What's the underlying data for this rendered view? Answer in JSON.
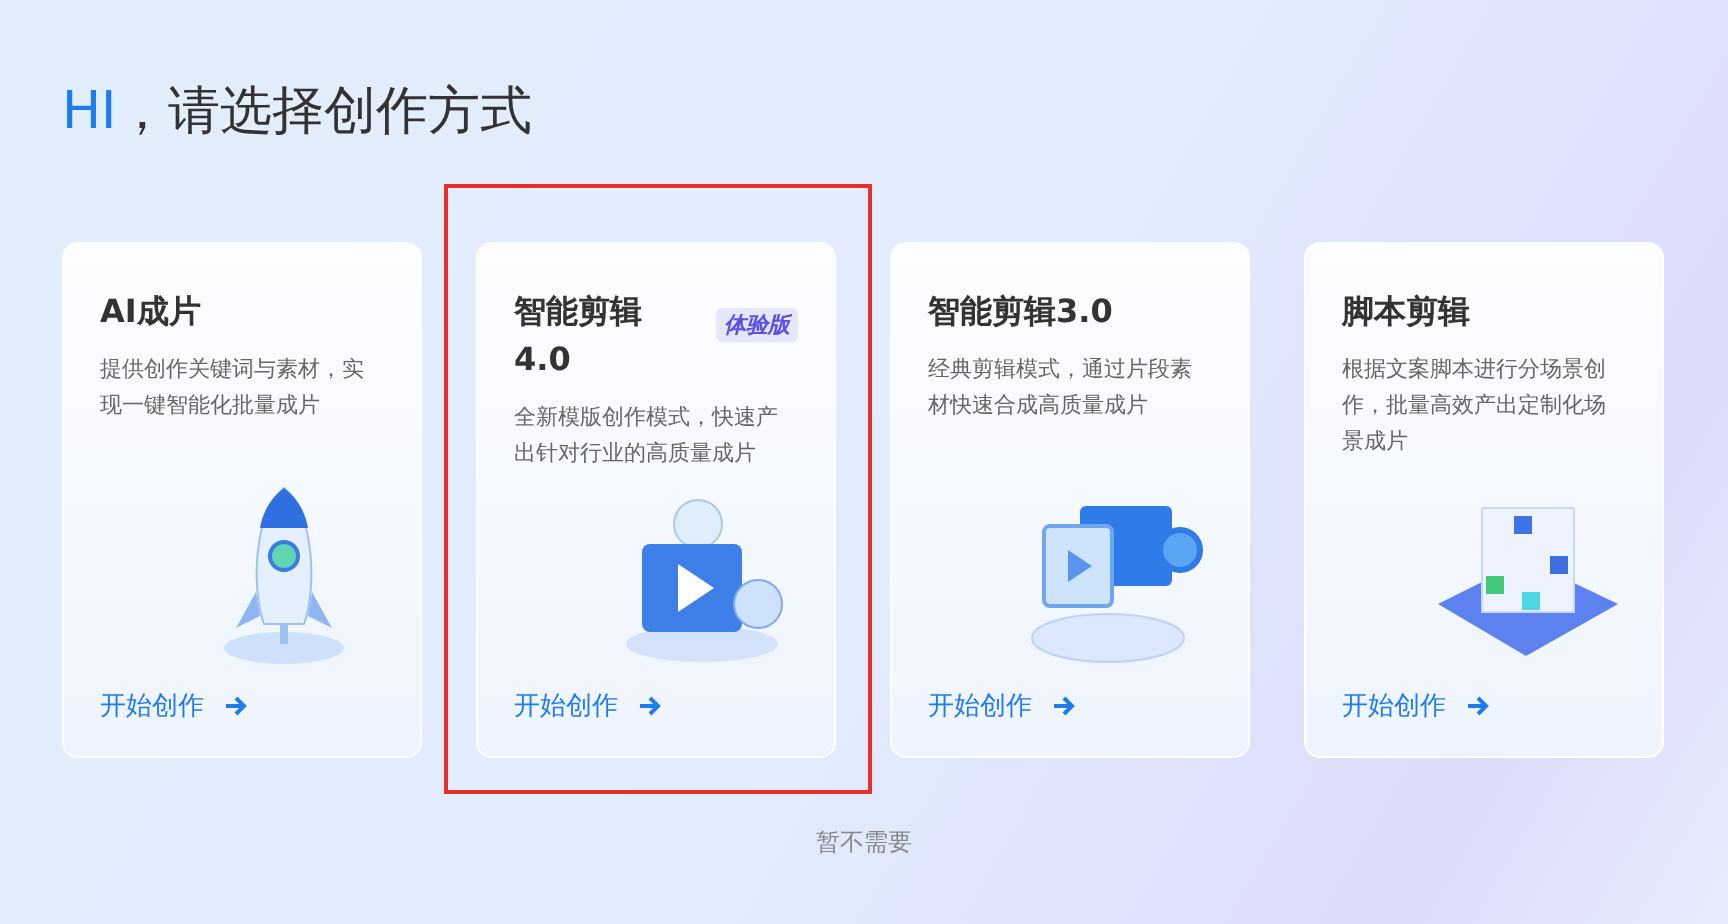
{
  "heading": {
    "highlight": "HI",
    "rest": "，请选择创作方式"
  },
  "cards": [
    {
      "title": "AI成片",
      "description": "提供创作关键词与素材，实现一键智能化批量成片",
      "kind": "rocket",
      "action": "开始创作",
      "selected": false
    },
    {
      "title": "智能剪辑4.0",
      "badge": "体验版",
      "description": "全新模版创作模式，快速产出针对行业的高质量成片",
      "kind": "film-box",
      "action": "开始创作",
      "selected": true
    },
    {
      "title": "智能剪辑3.0",
      "description": "经典剪辑模式，通过片段素材快速合成高质量成片",
      "kind": "camera",
      "action": "开始创作",
      "selected": false
    },
    {
      "title": "脚本剪辑",
      "description": "根据文案脚本进行分场景创作，批量高效产出定制化场景成片",
      "kind": "cube",
      "action": "开始创作",
      "selected": false
    }
  ],
  "skip_link": "暂不需要"
}
